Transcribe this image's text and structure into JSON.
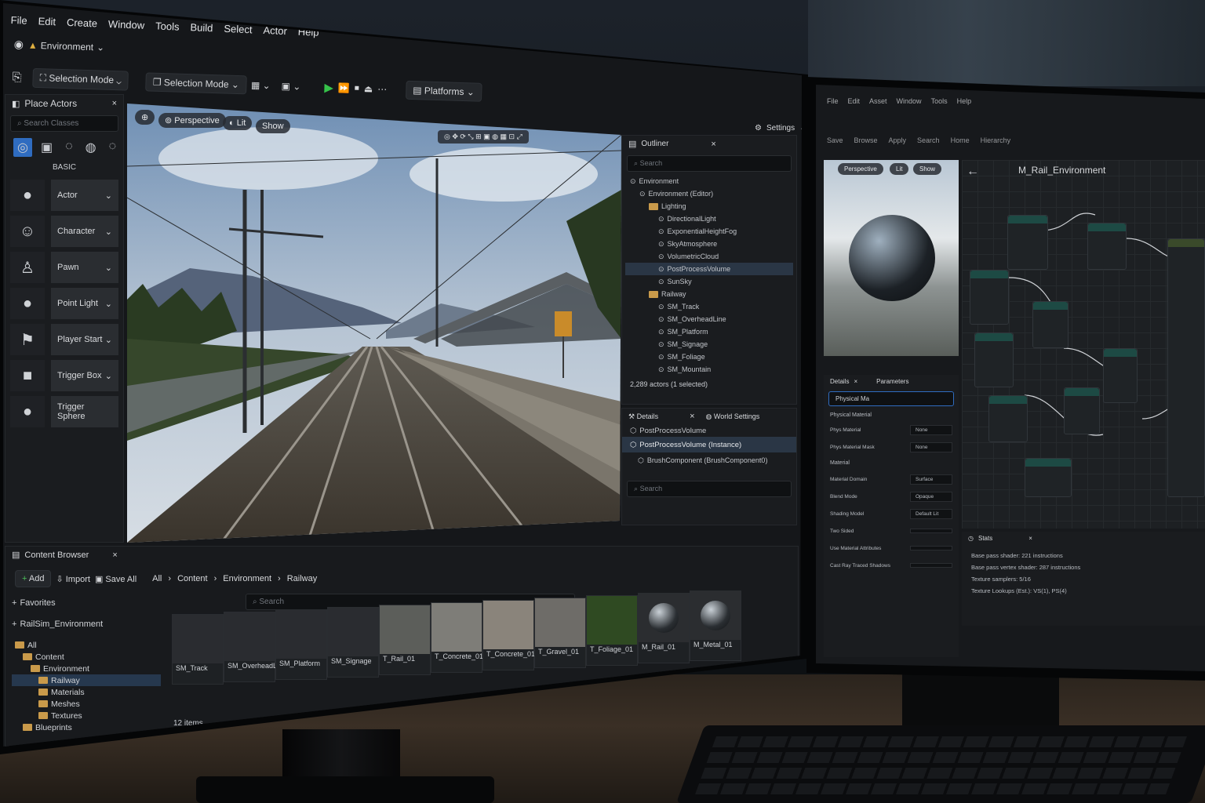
{
  "main_editor": {
    "menu": [
      "File",
      "Edit",
      "Create",
      "Window",
      "Tools",
      "Build",
      "Select",
      "Actor",
      "Help"
    ],
    "environment_dropdown": "Environment",
    "toolbar": {
      "selection_mode_1": "Selection Mode",
      "selection_mode_2": "Selection Mode",
      "platforms": "Platforms",
      "settings": "Settings"
    },
    "place_actors": {
      "title": "Place Actors",
      "search_placeholder": "Search Classes",
      "category": "BASIC",
      "items": [
        {
          "label": "Actor",
          "icon": "sphere-icon"
        },
        {
          "label": "Character",
          "icon": "character-icon"
        },
        {
          "label": "Pawn",
          "icon": "pawn-icon"
        },
        {
          "label": "Point Light",
          "icon": "light-bulb-icon"
        },
        {
          "label": "Player Start",
          "icon": "flag-icon"
        },
        {
          "label": "Trigger Box",
          "icon": "cube-icon"
        },
        {
          "label": "Trigger Sphere",
          "icon": "sphere-icon"
        }
      ]
    },
    "viewport": {
      "perspective": "Perspective",
      "lit": "Lit",
      "show": "Show"
    },
    "outliner": {
      "title": "Outliner",
      "search_placeholder": "Search",
      "rows": [
        {
          "label": "Environment",
          "indent": 0
        },
        {
          "label": "Environment (Editor)",
          "indent": 1
        },
        {
          "label": "Lighting",
          "indent": 2,
          "folder": true
        },
        {
          "label": "DirectionalLight",
          "indent": 3
        },
        {
          "label": "ExponentialHeightFog",
          "indent": 3
        },
        {
          "label": "SkyAtmosphere",
          "indent": 3
        },
        {
          "label": "VolumetricCloud",
          "indent": 3
        },
        {
          "label": "PostProcessVolume",
          "indent": 3,
          "selected": true
        },
        {
          "label": "SunSky",
          "indent": 3
        },
        {
          "label": "Railway",
          "indent": 2,
          "folder": true
        },
        {
          "label": "SM_Track",
          "indent": 3
        },
        {
          "label": "SM_OverheadLine",
          "indent": 3
        },
        {
          "label": "SM_Platform",
          "indent": 3
        },
        {
          "label": "SM_Signage",
          "indent": 3
        },
        {
          "label": "SM_Foliage",
          "indent": 3
        },
        {
          "label": "SM_Mountain",
          "indent": 3
        }
      ],
      "status": "2,289 actors (1 selected)"
    },
    "details": {
      "tab1": "Details",
      "tab2": "World Settings",
      "object": "PostProcessVolume",
      "instance": "PostProcessVolume (Instance)",
      "component": "BrushComponent (BrushComponent0)",
      "search_placeholder": "Search"
    },
    "content_browser": {
      "title": "Content Browser",
      "add": "Add",
      "import": "Import",
      "save_all": "Save All",
      "breadcrumb": [
        "All",
        "Content",
        "Environment",
        "Railway"
      ],
      "favorites": "Favorites",
      "project": "RailSim_Environment",
      "search_placeholder": "Search",
      "tree": [
        {
          "label": "All",
          "indent": 0
        },
        {
          "label": "Content",
          "indent": 1
        },
        {
          "label": "Environment",
          "indent": 2
        },
        {
          "label": "Railway",
          "indent": 3,
          "selected": true
        },
        {
          "label": "Materials",
          "indent": 3
        },
        {
          "label": "Meshes",
          "indent": 3
        },
        {
          "label": "Textures",
          "indent": 3
        },
        {
          "label": "Blueprints",
          "indent": 1
        }
      ],
      "assets": [
        {
          "label": "SM_Track",
          "color": "#2a2c30"
        },
        {
          "label": "SM_OverheadLine",
          "color": "#2a2c30"
        },
        {
          "label": "SM_Platform",
          "color": "#2a2c30"
        },
        {
          "label": "SM_Signage",
          "color": "#2a2c30"
        },
        {
          "label": "T_Rail_01",
          "color": "#5c5e5a"
        },
        {
          "label": "T_Concrete_01",
          "color": "#7e7d78"
        },
        {
          "label": "T_Concrete_01",
          "color": "#8a847b"
        },
        {
          "label": "T_Gravel_01",
          "color": "#6e6c68"
        },
        {
          "label": "T_Foliage_01",
          "color": "#2f4a22"
        },
        {
          "label": "M_Rail_01",
          "color": "#2b2d30"
        },
        {
          "label": "M_Metal_01",
          "color": "#2b2d30"
        }
      ],
      "item_count": "12 items"
    }
  },
  "material_editor": {
    "menu": [
      "File",
      "Edit",
      "Asset",
      "Window",
      "Tools",
      "Help"
    ],
    "toolbar": [
      "Save",
      "Browse",
      "Apply",
      "Search",
      "Home",
      "Hierarchy"
    ],
    "preview": {
      "perspective": "Perspective",
      "lit": "Lit",
      "show": "Show"
    },
    "graph_title": "M_Rail_Environment",
    "details_tab": "Details",
    "parameters_tab": "Parameters",
    "details_search": "Physical Ma",
    "sections": {
      "physical": "Physical Material",
      "material": "Material"
    },
    "props": [
      {
        "label": "Phys Material",
        "value": "None"
      },
      {
        "label": "Phys Material Mask",
        "value": "None"
      },
      {
        "label": "Material Domain",
        "value": "Surface"
      },
      {
        "label": "Blend Mode",
        "value": "Opaque"
      },
      {
        "label": "Shading Model",
        "value": "Default Lit"
      },
      {
        "label": "Two Sided",
        "value": ""
      },
      {
        "label": "Use Material Attributes",
        "value": ""
      },
      {
        "label": "Cast Ray Traced Shadows",
        "value": ""
      }
    ],
    "stats": {
      "title": "Stats",
      "lines": [
        "Base pass shader: 221 instructions",
        "Base pass vertex shader: 287 instructions",
        "Texture samplers: 5/16",
        "Texture Lookups (Est.): VS(1), PS(4)"
      ]
    }
  }
}
